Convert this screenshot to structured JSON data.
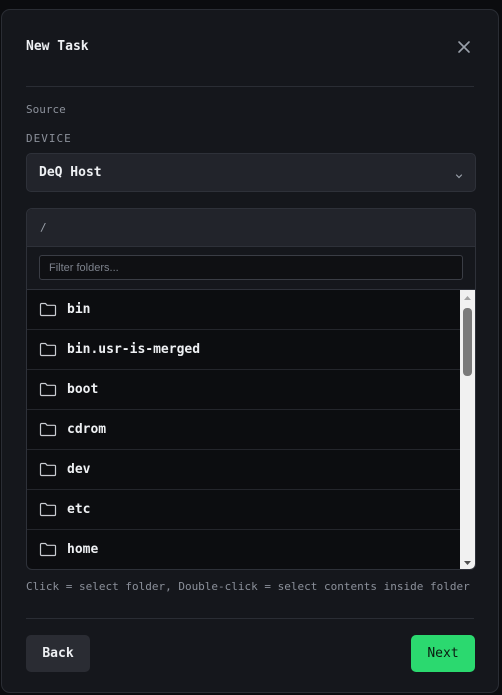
{
  "dialog": {
    "title": "New Task"
  },
  "source": {
    "section_label": "Source",
    "device_label": "DEVICE",
    "device_value": "DeQ Host"
  },
  "browser": {
    "current_path": "/",
    "filter_placeholder": "Filter folders...",
    "folders": [
      "bin",
      "bin.usr-is-merged",
      "boot",
      "cdrom",
      "dev",
      "etc",
      "home"
    ]
  },
  "hint": "Click = select folder, Double-click = select contents inside folder",
  "footer": {
    "back_label": "Back",
    "next_label": "Next"
  },
  "colors": {
    "accent": "#2bd96f",
    "background": "#15171c"
  }
}
